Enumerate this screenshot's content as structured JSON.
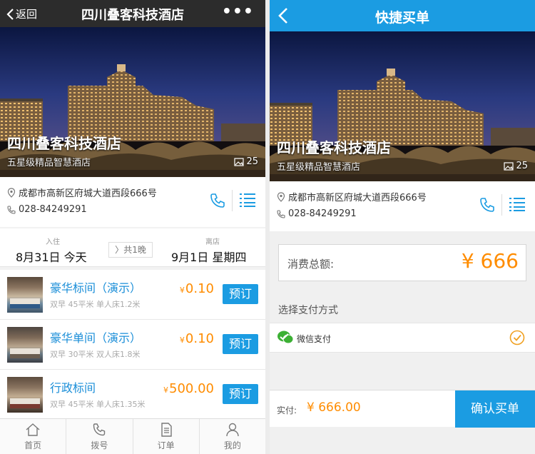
{
  "colors": {
    "accent": "#1b9ce2",
    "price": "#ff8c00",
    "dark_nav": "#2c2c2c"
  },
  "left": {
    "nav": {
      "back_label": "返回",
      "title": "四川叠客科技酒店",
      "more_label": "•••"
    },
    "hero": {
      "name": "四川叠客科技酒店",
      "subtitle": "五星级精品智慧酒店",
      "photo_count": "25"
    },
    "info": {
      "address": "成都市高新区府城大道西段666号",
      "phone": "028-84249291"
    },
    "dates": {
      "checkin_label": "入住",
      "checkin_value": "8月31日 今天",
      "nights": "共1晚",
      "checkout_label": "离店",
      "checkout_value": "9月1日 星期四"
    },
    "rooms": [
      {
        "name": "豪华标间（演示）",
        "spec": "双早 45平米 单人床1.2米",
        "currency": "¥",
        "price": "0.10",
        "book_label": "预订"
      },
      {
        "name": "豪华单间（演示）",
        "spec": "双早 30平米 双人床1.8米",
        "currency": "¥",
        "price": "0.10",
        "book_label": "预订"
      },
      {
        "name": "行政标间",
        "spec": "双早 45平米 单人床1.35米",
        "currency": "¥",
        "price": "500.00",
        "book_label": "预订"
      }
    ],
    "tabbar": [
      {
        "label": "首页",
        "icon": "home-icon"
      },
      {
        "label": "拨号",
        "icon": "phone-icon"
      },
      {
        "label": "订单",
        "icon": "document-icon"
      },
      {
        "label": "我的",
        "icon": "user-icon"
      }
    ]
  },
  "right": {
    "nav": {
      "title": "快捷买单"
    },
    "hero": {
      "name": "四川叠客科技酒店",
      "subtitle": "五星级精品智慧酒店",
      "photo_count": "25"
    },
    "info": {
      "address": "成都市高新区府城大道西段666号",
      "phone": "028-84249291"
    },
    "total": {
      "label": "消费总额:",
      "amount": "¥ 666"
    },
    "pay_title": "选择支付方式",
    "pay_method": {
      "label": "微信支付",
      "icon": "wechat-icon",
      "selected": true
    },
    "footer": {
      "paid_label": "实付:",
      "paid_amount": "¥ 666.00",
      "confirm_label": "确认买单"
    }
  }
}
